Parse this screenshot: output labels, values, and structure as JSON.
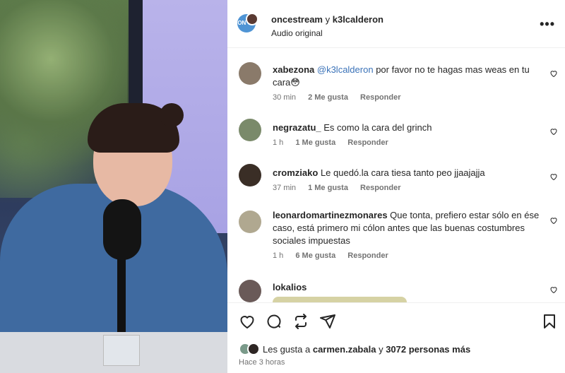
{
  "post": {
    "account": "oncestream",
    "separator": "y",
    "collaborator": "k3lcalderon",
    "audio_label": "Audio original",
    "avatar_text": "ON CE",
    "more_icon": "more-horizontal-icon"
  },
  "comments": [
    {
      "user": "xabezona",
      "mention": "@k3lcalderon",
      "text": "por favor no te hagas mas weas en tu cara😳",
      "time": "30 min",
      "likes": "2 Me gusta",
      "reply": "Responder",
      "avatar_color": "#8a7a6a"
    },
    {
      "user": "negrazatu_",
      "mention": "",
      "text": "Es como la cara del grinch",
      "time": "1 h",
      "likes": "1 Me gusta",
      "reply": "Responder",
      "avatar_color": "#7a8a6a"
    },
    {
      "user": "cromziako",
      "mention": "",
      "text": "Le quedó.la cara tiesa tanto peo jjaajajja",
      "time": "37 min",
      "likes": "1 Me gusta",
      "reply": "Responder",
      "avatar_color": "#3a2e26"
    },
    {
      "user": "leonardomartinezmonares",
      "mention": "",
      "text": "Que tonta, prefiero estar sólo en ése caso, está primero mi cólon antes que las buenas costumbres sociales impuestas",
      "time": "1 h",
      "likes": "6 Me gusta",
      "reply": "Responder",
      "avatar_color": "#b0a890"
    },
    {
      "user": "lokalios",
      "mention": "",
      "text": "",
      "time": "",
      "likes": "",
      "reply": "",
      "avatar_color": "#6a5a58"
    }
  ],
  "likes_summary": {
    "prefix": "Les gusta a",
    "user": "carmen.zabala",
    "middle": "y",
    "others": "3072 personas más"
  },
  "timestamp": "Hace 3 horas",
  "colors": {
    "mention": "#3a72b8",
    "meta": "#737373",
    "text": "#262626"
  }
}
